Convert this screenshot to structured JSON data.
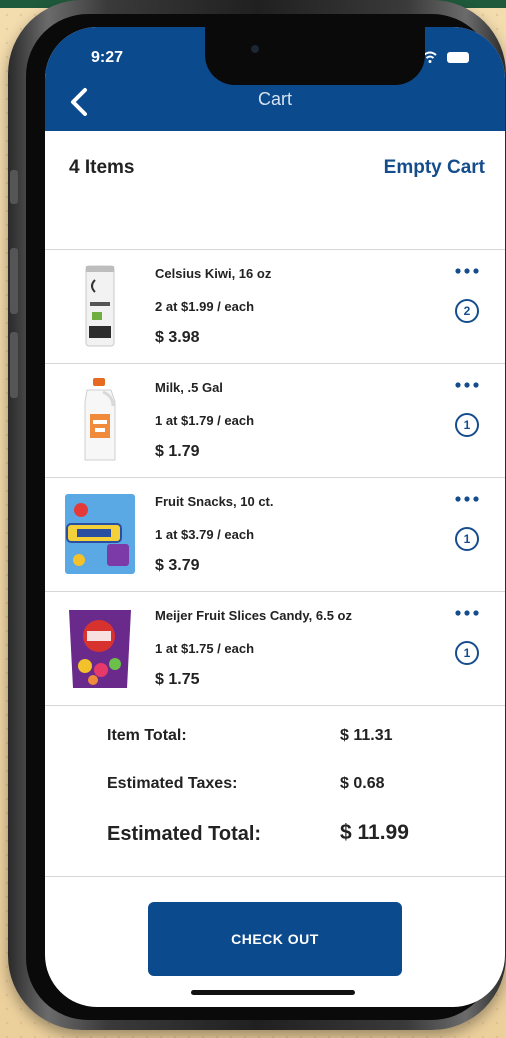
{
  "status_bar": {
    "time": "9:27"
  },
  "header": {
    "title": "Cart"
  },
  "cart": {
    "items_count": "4 Items",
    "empty_cart_label": "Empty Cart"
  },
  "items": [
    {
      "name": "Celsius Kiwi, 16 oz",
      "qty_line": "2 at $1.99 / each",
      "price": "$ 3.98",
      "quantity": "2",
      "thumb_icon": "celsius-can-icon"
    },
    {
      "name": "Milk, .5 Gal",
      "qty_line": "1 at $1.79 / each",
      "price": "$ 1.79",
      "quantity": "1",
      "thumb_icon": "milk-jug-icon"
    },
    {
      "name": "Fruit Snacks, 10 ct.",
      "qty_line": "1 at $3.79 / each",
      "price": "$ 3.79",
      "quantity": "1",
      "thumb_icon": "fruit-snacks-box-icon"
    },
    {
      "name": "Meijer Fruit Slices Candy, 6.5 oz",
      "qty_line": "1 at $1.75 / each",
      "price": "$ 1.75",
      "quantity": "1",
      "thumb_icon": "candy-bag-icon"
    }
  ],
  "totals": {
    "item_total_label": "Item Total:",
    "item_total": "$ 11.31",
    "taxes_label": "Estimated Taxes:",
    "taxes": "$ 0.68",
    "estimated_total_label": "Estimated Total:",
    "estimated_total": "$ 11.99"
  },
  "checkout": {
    "label": "CHECK OUT"
  },
  "colors": {
    "brand_blue": "#0c4a8e",
    "link_blue": "#154d8c",
    "backdrop": "#f1d7a6"
  }
}
